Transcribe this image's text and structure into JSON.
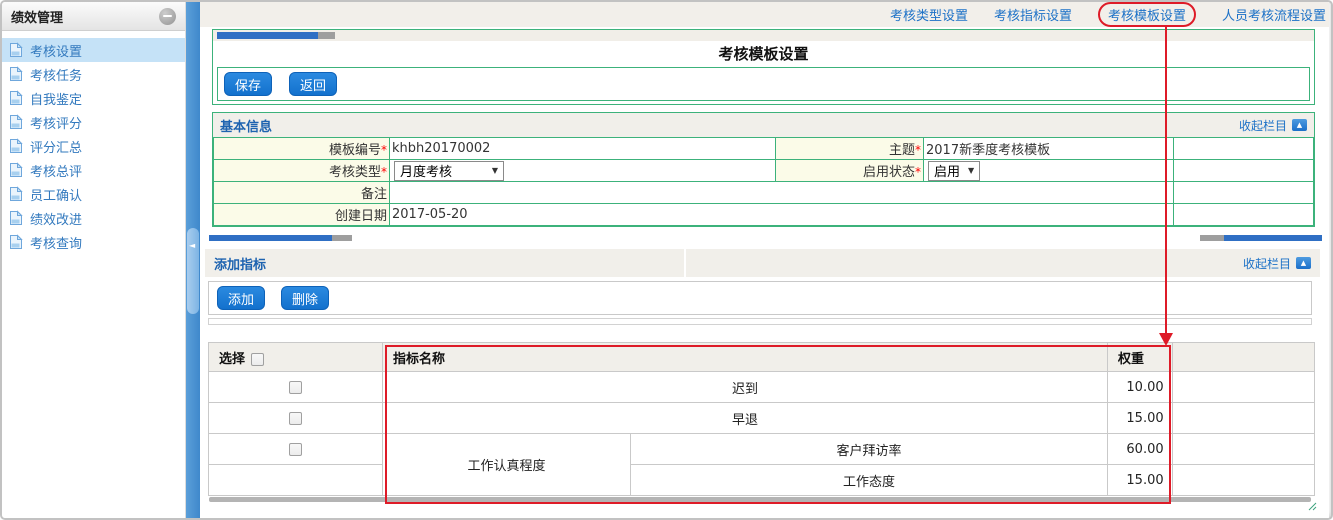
{
  "ui": {
    "required_marker": "*",
    "dropdown_arrow": "▼",
    "collapse_arrow": "▲",
    "splitter_arrow": "◄",
    "collapse_label": "收起栏目"
  },
  "colors": {
    "accent_blue": "#1678d3",
    "link_blue": "#1c71c7",
    "border_green": "#3cb27b",
    "annotation_red": "#de1b28",
    "label_cell_cream": "#fbfbe8",
    "selected_item_blue": "#c5e2f7"
  },
  "sidebar": {
    "title": "绩效管理",
    "items": [
      {
        "label": "考核设置",
        "selected": true
      },
      {
        "label": "考核任务",
        "selected": false
      },
      {
        "label": "自我鉴定",
        "selected": false
      },
      {
        "label": "考核评分",
        "selected": false
      },
      {
        "label": "评分汇总",
        "selected": false
      },
      {
        "label": "考核总评",
        "selected": false
      },
      {
        "label": "员工确认",
        "selected": false
      },
      {
        "label": "绩效改进",
        "selected": false
      },
      {
        "label": "考核查询",
        "selected": false
      }
    ]
  },
  "top_nav": {
    "links": [
      {
        "label": "考核类型设置",
        "highlighted": false
      },
      {
        "label": "考核指标设置",
        "highlighted": false
      },
      {
        "label": "考核模板设置",
        "highlighted": true
      },
      {
        "label": "人员考核流程设置",
        "highlighted": false
      }
    ]
  },
  "page": {
    "title": "考核模板设置",
    "toolbar": {
      "save": "保存",
      "back": "返回"
    }
  },
  "basic_info": {
    "header": "基本信息",
    "fields": {
      "template_no_label": "模板编号",
      "template_no_value": "khbh20170002",
      "subject_label": "主题",
      "subject_value": "2017新季度考核模板",
      "type_label": "考核类型",
      "type_value": "月度考核",
      "status_label": "启用状态",
      "status_value": "启用",
      "remark_label": "备注",
      "remark_value": "",
      "created_label": "创建日期",
      "created_value": "2017-05-20"
    }
  },
  "indicators": {
    "header": "添加指标",
    "toolbar": {
      "add": "添加",
      "delete": "删除"
    },
    "table": {
      "headers": {
        "select": "选择",
        "name": "指标名称",
        "weight": "权重"
      },
      "rows": [
        {
          "name": "迟到",
          "weight": "10.00"
        },
        {
          "name": "早退",
          "weight": "15.00"
        },
        {
          "group": "工作认真程度",
          "name": "客户拜访率",
          "weight": "60.00"
        },
        {
          "name": "工作态度",
          "weight": "15.00"
        }
      ]
    }
  }
}
